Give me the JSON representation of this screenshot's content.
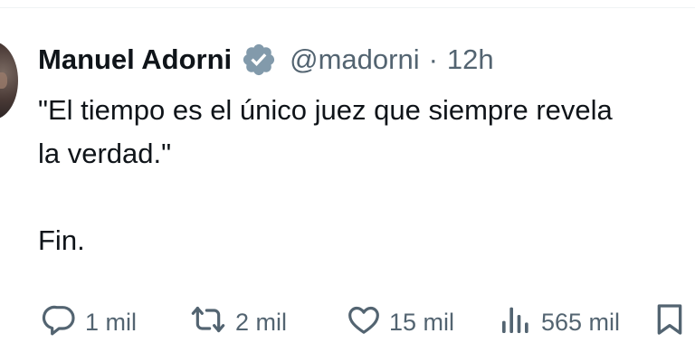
{
  "tweet": {
    "author_name": "Manuel Adorni",
    "handle": "@madorni",
    "separator": "·",
    "time": "12h",
    "text": "\"El tiempo es el único juez que siempre revela\nla verdad.\"\n\nFin."
  },
  "actions": {
    "reply_count": "1 mil",
    "retweet_count": "2 mil",
    "like_count": "15 mil",
    "views_count": "565 mil"
  },
  "colors": {
    "text": "#0f1419",
    "secondary": "#536471",
    "verified_badge": "#829aab"
  },
  "icons": [
    "verified-badge-icon",
    "reply-icon",
    "retweet-icon",
    "like-icon",
    "views-icon",
    "bookmark-icon"
  ]
}
